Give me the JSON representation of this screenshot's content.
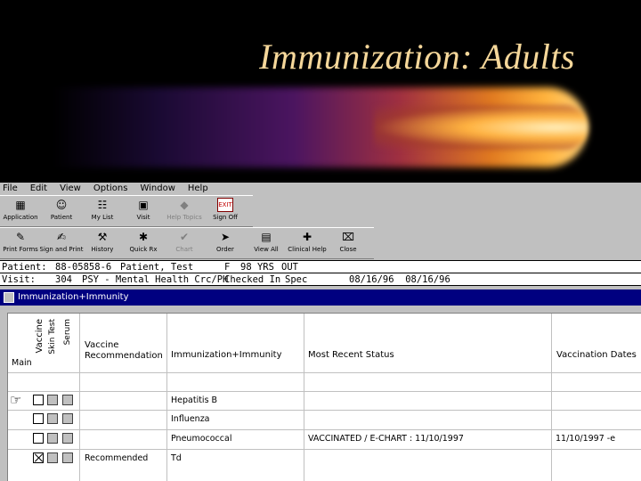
{
  "slide": {
    "title": "Immunization: Adults"
  },
  "menu": [
    "File",
    "Edit",
    "View",
    "Options",
    "Window",
    "Help"
  ],
  "toolbar1": [
    {
      "label": "Application",
      "icon": "application-icon",
      "glyph": "▦",
      "enabled": true
    },
    {
      "label": "Patient",
      "icon": "patient-icon",
      "glyph": "☺",
      "enabled": true
    },
    {
      "label": "My List",
      "icon": "my-list-icon",
      "glyph": "☷",
      "enabled": true
    },
    {
      "label": "Visit",
      "icon": "visit-icon",
      "glyph": "▣",
      "enabled": true
    },
    {
      "label": "Help Topics",
      "icon": "help-topics-icon",
      "glyph": "◆",
      "enabled": false
    },
    {
      "label": "Sign Off",
      "icon": "exit-icon",
      "glyph": "EXIT",
      "enabled": true
    }
  ],
  "toolbar2": [
    {
      "label": "Print Forms",
      "icon": "print-forms-icon",
      "glyph": "✎",
      "enabled": true
    },
    {
      "label": "Sign and Print",
      "icon": "sign-and-print-icon",
      "glyph": "✍",
      "enabled": true
    },
    {
      "label": "History",
      "icon": "history-icon",
      "glyph": "⚒",
      "enabled": true
    },
    {
      "label": "Quick Rx",
      "icon": "quick-rx-icon",
      "glyph": "✱",
      "enabled": true
    },
    {
      "label": "Chart",
      "icon": "chart-icon",
      "glyph": "✔",
      "enabled": false
    },
    {
      "label": "Order",
      "icon": "order-icon",
      "glyph": "➤",
      "enabled": true
    },
    {
      "label": "View All",
      "icon": "view-all-icon",
      "glyph": "▤",
      "enabled": true
    },
    {
      "label": "Clinical Help",
      "icon": "clinical-help-icon",
      "glyph": "✚",
      "enabled": true
    },
    {
      "label": "Close",
      "icon": "close-icon",
      "glyph": "⌧",
      "enabled": true
    }
  ],
  "patient_bar": {
    "patient_label": "Patient:",
    "patient_id": "88-05858-6",
    "patient_name": "Patient, Test",
    "sex": "F",
    "age": "98 YRS",
    "status": "OUT",
    "visit_label": "Visit:",
    "visit_code": "304",
    "visit_desc": "PSY - Mental Health Crc/PH",
    "checkin": "Checked In",
    "spec": "Spec",
    "dates": "08/16/96  08/16/96"
  },
  "window": {
    "title": "Immunization+Immunity"
  },
  "table": {
    "headers": {
      "main": "Main",
      "vaccine": "Vaccine",
      "skin_test": "Skin Test",
      "serum": "Serum",
      "recommendation": "Vaccine\nRecommendation",
      "immunization": "Immunization+Immunity",
      "status": "Most Recent Status",
      "dates": "Vaccination Dates"
    },
    "rows": [
      {
        "checked": false,
        "recommendation": "",
        "name": "Hepatitis B",
        "status": "",
        "dates": ""
      },
      {
        "checked": false,
        "recommendation": "",
        "name": "Influenza",
        "status": "",
        "dates": ""
      },
      {
        "checked": false,
        "recommendation": "",
        "name": "Pneumococcal",
        "status": "VACCINATED / E-CHART : 11/10/1997",
        "dates": "11/10/1997 -e"
      },
      {
        "checked": true,
        "recommendation": "Recommended",
        "name": "Td",
        "status": "",
        "dates": ""
      }
    ]
  }
}
